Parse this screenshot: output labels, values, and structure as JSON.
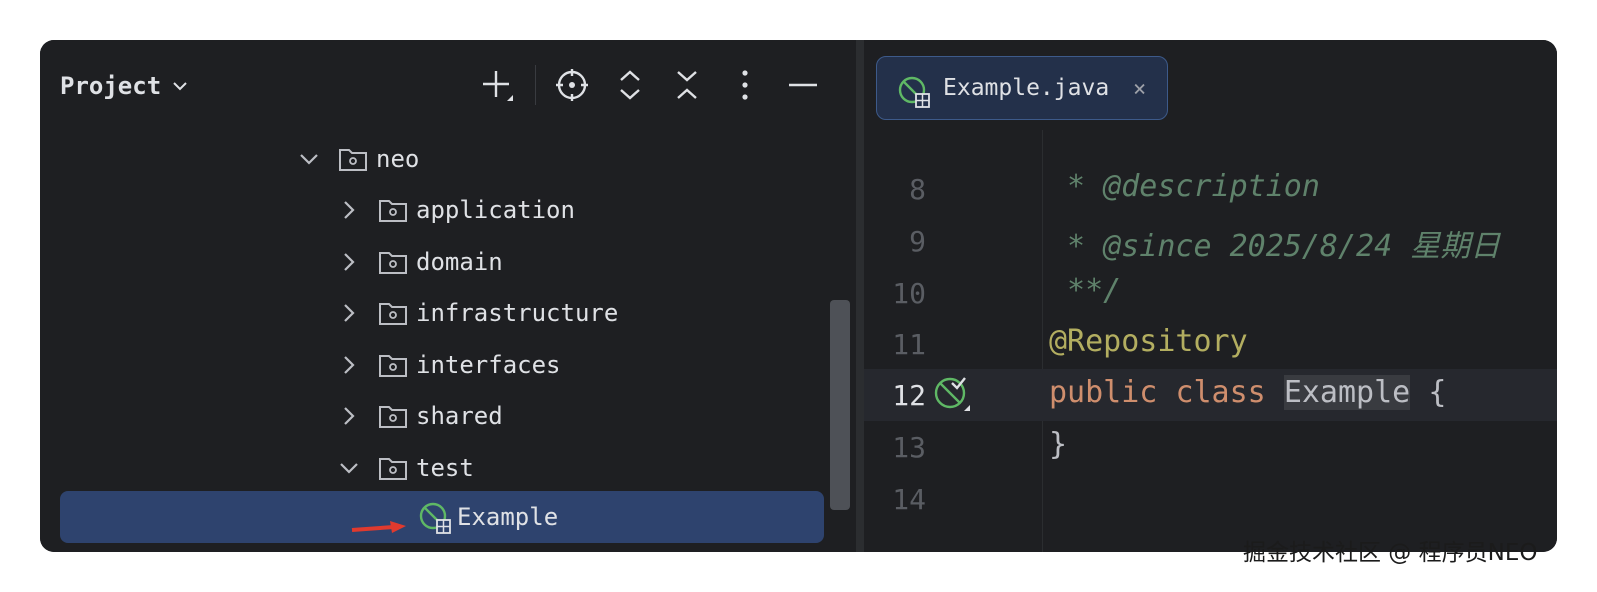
{
  "project_panel": {
    "title": "Project",
    "toolbar": {
      "add": "plus-icon",
      "locate": "crosshair-icon",
      "expand": "expand-all-icon",
      "collapse": "collapse-all-icon",
      "more": "more-icon",
      "hide": "minimize-icon"
    },
    "tree": [
      {
        "label": "neo",
        "expanded": true
      },
      {
        "label": "application",
        "expanded": false
      },
      {
        "label": "domain",
        "expanded": false
      },
      {
        "label": "infrastructure",
        "expanded": false
      },
      {
        "label": "interfaces",
        "expanded": false
      },
      {
        "label": "shared",
        "expanded": false
      },
      {
        "label": "test",
        "expanded": true
      },
      {
        "label": "Example",
        "selected": true
      }
    ]
  },
  "editor": {
    "tab": {
      "label": "Example.java",
      "close": "×"
    },
    "lines": [
      {
        "num": "8",
        "text": " * @description"
      },
      {
        "num": "9",
        "text": " * @since 2025/8/24 星期日"
      },
      {
        "num": "10",
        "text": " **/"
      },
      {
        "num": "11",
        "text": "@Repository"
      },
      {
        "num": "12",
        "kw1": "public",
        "kw2": "class",
        "cls": "Example",
        "brace": "{"
      },
      {
        "num": "13",
        "text": "}"
      },
      {
        "num": "14",
        "text": ""
      }
    ]
  },
  "watermark": "掘金技术社区 @ 程序员NEO",
  "colors": {
    "background": "#1e1f22",
    "selection": "#2e436e",
    "comment": "#5f826b",
    "keyword": "#cf8e6d",
    "annotation": "#b3ae60",
    "bean_icon": "#5fb865"
  }
}
